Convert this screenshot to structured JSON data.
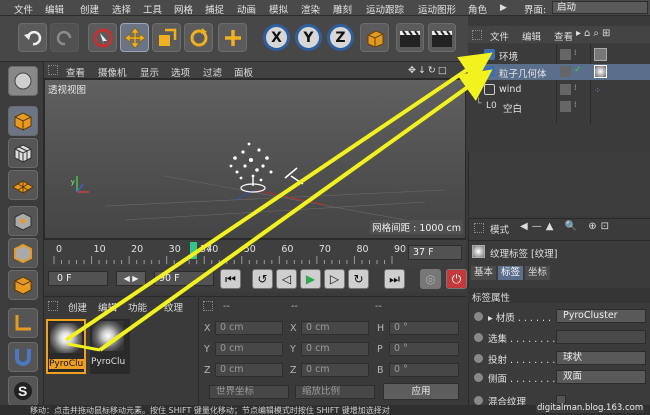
{
  "menubar": {
    "items": [
      "文件",
      "编辑",
      "创建",
      "选择",
      "工具",
      "网格",
      "捕捉",
      "动画",
      "模拟",
      "渲染",
      "雕刻",
      "运动跟踪",
      "运动图形",
      "角色"
    ],
    "layout_label": "界面:",
    "layout_value": "启动"
  },
  "toolbar": {
    "buttons": [
      "undo-icon",
      "redo-icon",
      "live-select-icon",
      "move-icon",
      "scale-icon",
      "rotate-icon",
      "add-icon"
    ],
    "axis": [
      "X",
      "Y",
      "Z"
    ]
  },
  "viewport": {
    "menu": [
      "查看",
      "摄像机",
      "显示",
      "选项",
      "过滤",
      "面板"
    ],
    "name": "透视视图",
    "grid_label": "网格间距 : 1000 cm"
  },
  "timeline": {
    "ticks": [
      "0",
      "10",
      "20",
      "30",
      "37",
      "40",
      "50",
      "60",
      "70",
      "80",
      "90"
    ],
    "current_frame": "37 F",
    "current_value": 37,
    "range": [
      0,
      90
    ]
  },
  "transport": {
    "start_field": "0 F",
    "end_field": "90 F"
  },
  "material_panel": {
    "menu": [
      "创建",
      "编辑",
      "功能",
      "纹理"
    ],
    "materials": [
      "PyroClu",
      "PyroClu"
    ]
  },
  "coord_panel": {
    "header": [
      "--",
      "--",
      "--"
    ],
    "rows": [
      {
        "axis1": "X",
        "v1": "0 cm",
        "axis2": "X",
        "v2": "0 cm",
        "axis3": "H",
        "v3": "0 °"
      },
      {
        "axis1": "Y",
        "v1": "0 cm",
        "axis2": "Y",
        "v2": "0 cm",
        "axis3": "P",
        "v3": "0 °"
      },
      {
        "axis1": "Z",
        "v1": "0 cm",
        "axis2": "Z",
        "v2": "0 cm",
        "axis3": "B",
        "v3": "0 °"
      }
    ],
    "world_dropdown": "世界坐标",
    "scale_dropdown": "缩放比例",
    "apply_button": "应用"
  },
  "object_manager": {
    "menu": [
      "文件",
      "编辑",
      "查看"
    ],
    "objects": [
      {
        "name": "环境",
        "icon": "environment-icon",
        "selected": false
      },
      {
        "name": "粒子几何体",
        "icon": "particle-geometry-icon",
        "selected": true
      },
      {
        "name": "wind",
        "icon": "wind-icon",
        "selected": false
      },
      {
        "name": "空白",
        "icon": "null-icon",
        "selected": false
      }
    ]
  },
  "attributes": {
    "menu": "模式",
    "tag_title": "纹理标签 [纹理]",
    "tabs": [
      "基本",
      "标签",
      "坐标"
    ],
    "section": "标签属性",
    "material_label": "材质",
    "material_value": "PyroCluster",
    "selection_label": "选集",
    "projection_label": "投射",
    "projection_value": "球状",
    "side_label": "侧面",
    "side_value": "双面",
    "mix_label": "混合纹理"
  },
  "status_bar": {
    "text": "移动：点击并拖动鼠标移动元素。按住 SHIFT 键量化移动；节点编辑模式时按住 SHIFT 键增加选择对"
  },
  "watermark": "digitalman.blog.163.com",
  "colors": {
    "arrow": "#f2f21e",
    "keyframe_marker": "#35c48a",
    "selection_highlight": "#5a6f8c",
    "play_green": "#2fa84f",
    "record_red": "#c43a3a"
  }
}
